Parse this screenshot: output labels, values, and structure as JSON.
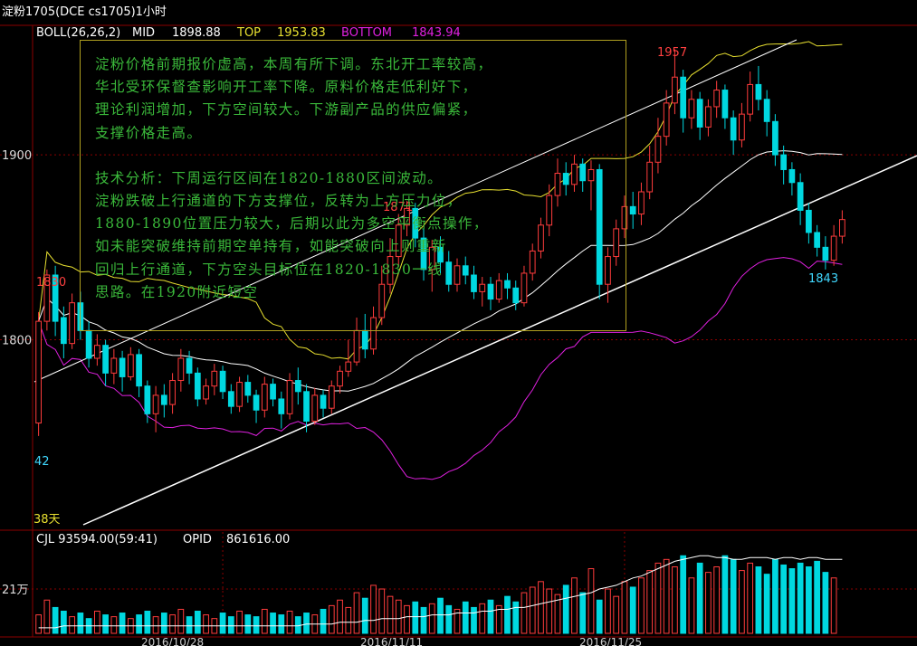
{
  "title": "淀粉1705(DCE cs1705)1小时",
  "indicator": {
    "name": "BOLL(26,26,2)",
    "mid_label": "MID",
    "mid_value": "1898.88",
    "top_label": "TOP",
    "top_value": "1953.83",
    "bottom_label": "BOTTOM",
    "bottom_value": "1843.94"
  },
  "volume_header": {
    "cjl": "CJL 93594.00(59:41)",
    "opid_label": "OPID",
    "opid_value": "861616.00"
  },
  "note": {
    "para1": "淀粉价格前期报价虚高，本周有所下调。东北开工率较高，\n华北受环保督查影响开工率下降。原料价格走低利好下，\n理论利润增加，下方空间较大。下游副产品的供应偏紧，\n支撑价格走高。",
    "para2": "技术分析：下周运行区间在1820-1880区间波动。\n淀粉跌破上行通道的下方支撑位，反转为上方压力位，\n1880-1890位置压力较大，后期以此为多空平衡点操作，\n如未能突破维持前期空单持有，如能突破向上则重新\n回归上行通道，下方空头目标位在1820-1830一线\n思路。在1920附近短空"
  },
  "annotations": {
    "high1": "1830",
    "high2": "1871",
    "high3": "1957",
    "low1": "1843",
    "left_low": "42",
    "days": "38天"
  },
  "colors": {
    "bg": "#000000",
    "up": "#ff3c3c",
    "down": "#00d8e0",
    "grid": "#8b0000",
    "mid": "#ffffff",
    "top": "#e8e030",
    "bottom": "#e020e0",
    "title": "#ffffff",
    "note": "#3ab83a"
  },
  "chart_data": {
    "type": "candlestick",
    "y_ticks": [
      1800,
      1900
    ],
    "ylim": [
      1700,
      1970
    ],
    "volume_tick": "21万",
    "x_ticks": [
      "2016/10/28",
      "2016/11/11",
      "2016/11/25"
    ],
    "x_tick_index": [
      22,
      70,
      118
    ],
    "candles": [
      [
        1755,
        1810,
        1748,
        1815
      ],
      [
        1810,
        1835,
        1805,
        1838
      ],
      [
        1835,
        1810,
        1802,
        1840
      ],
      [
        1812,
        1798,
        1790,
        1818
      ],
      [
        1798,
        1820,
        1795,
        1825
      ],
      [
        1820,
        1805,
        1800,
        1826
      ],
      [
        1805,
        1790,
        1785,
        1810
      ],
      [
        1790,
        1797,
        1786,
        1803
      ],
      [
        1797,
        1782,
        1775,
        1800
      ],
      [
        1782,
        1790,
        1776,
        1795
      ],
      [
        1790,
        1780,
        1772,
        1794
      ],
      [
        1780,
        1792,
        1778,
        1796
      ],
      [
        1792,
        1775,
        1769,
        1795
      ],
      [
        1775,
        1760,
        1755,
        1778
      ],
      [
        1760,
        1770,
        1750,
        1775
      ],
      [
        1770,
        1765,
        1758,
        1776
      ],
      [
        1765,
        1778,
        1760,
        1782
      ],
      [
        1778,
        1790,
        1772,
        1795
      ],
      [
        1790,
        1782,
        1776,
        1794
      ],
      [
        1782,
        1768,
        1764,
        1785
      ],
      [
        1768,
        1775,
        1765,
        1779
      ],
      [
        1775,
        1783,
        1770,
        1787
      ],
      [
        1783,
        1772,
        1768,
        1786
      ],
      [
        1772,
        1764,
        1760,
        1776
      ],
      [
        1764,
        1777,
        1761,
        1780
      ],
      [
        1777,
        1770,
        1766,
        1781
      ],
      [
        1770,
        1762,
        1755,
        1773
      ],
      [
        1762,
        1776,
        1758,
        1780
      ],
      [
        1776,
        1768,
        1764,
        1779
      ],
      [
        1768,
        1760,
        1752,
        1772
      ],
      [
        1760,
        1778,
        1757,
        1782
      ],
      [
        1778,
        1772,
        1765,
        1785
      ],
      [
        1772,
        1756,
        1750,
        1776
      ],
      [
        1756,
        1770,
        1754,
        1774
      ],
      [
        1770,
        1763,
        1758,
        1773
      ],
      [
        1763,
        1775,
        1760,
        1778
      ],
      [
        1775,
        1783,
        1771,
        1786
      ],
      [
        1783,
        1788,
        1780,
        1800
      ],
      [
        1788,
        1805,
        1786,
        1812
      ],
      [
        1805,
        1795,
        1790,
        1814
      ],
      [
        1795,
        1812,
        1792,
        1818
      ],
      [
        1812,
        1830,
        1808,
        1840
      ],
      [
        1830,
        1845,
        1825,
        1855
      ],
      [
        1845,
        1862,
        1840,
        1868
      ],
      [
        1862,
        1871,
        1856,
        1875
      ],
      [
        1871,
        1855,
        1850,
        1874
      ],
      [
        1855,
        1838,
        1832,
        1860
      ],
      [
        1838,
        1850,
        1826,
        1854
      ],
      [
        1850,
        1842,
        1836,
        1856
      ],
      [
        1842,
        1830,
        1826,
        1848
      ],
      [
        1830,
        1840,
        1826,
        1844
      ],
      [
        1840,
        1835,
        1830,
        1845
      ],
      [
        1835,
        1826,
        1822,
        1840
      ],
      [
        1826,
        1830,
        1818,
        1834
      ],
      [
        1830,
        1822,
        1816,
        1834
      ],
      [
        1822,
        1832,
        1820,
        1836
      ],
      [
        1832,
        1828,
        1822,
        1836
      ],
      [
        1828,
        1820,
        1816,
        1832
      ],
      [
        1820,
        1836,
        1818,
        1840
      ],
      [
        1836,
        1848,
        1832,
        1852
      ],
      [
        1848,
        1862,
        1844,
        1866
      ],
      [
        1862,
        1878,
        1856,
        1884
      ],
      [
        1878,
        1890,
        1872,
        1898
      ],
      [
        1890,
        1884,
        1878,
        1896
      ],
      [
        1884,
        1895,
        1880,
        1900
      ],
      [
        1895,
        1886,
        1880,
        1898
      ],
      [
        1886,
        1892,
        1870,
        1897
      ],
      [
        1892,
        1830,
        1822,
        1895
      ],
      [
        1830,
        1845,
        1820,
        1850
      ],
      [
        1845,
        1860,
        1840,
        1865
      ],
      [
        1860,
        1872,
        1855,
        1878
      ],
      [
        1872,
        1868,
        1860,
        1880
      ],
      [
        1868,
        1880,
        1862,
        1885
      ],
      [
        1880,
        1896,
        1876,
        1905
      ],
      [
        1896,
        1910,
        1890,
        1920
      ],
      [
        1910,
        1928,
        1905,
        1935
      ],
      [
        1928,
        1942,
        1922,
        1957
      ],
      [
        1942,
        1920,
        1912,
        1946
      ],
      [
        1920,
        1930,
        1914,
        1935
      ],
      [
        1930,
        1915,
        1908,
        1934
      ],
      [
        1915,
        1926,
        1910,
        1930
      ],
      [
        1926,
        1935,
        1920,
        1940
      ],
      [
        1935,
        1920,
        1914,
        1938
      ],
      [
        1920,
        1908,
        1900,
        1924
      ],
      [
        1908,
        1922,
        1904,
        1928
      ],
      [
        1922,
        1938,
        1918,
        1945
      ],
      [
        1938,
        1930,
        1924,
        1948
      ],
      [
        1930,
        1918,
        1910,
        1935
      ],
      [
        1918,
        1900,
        1894,
        1922
      ],
      [
        1900,
        1892,
        1884,
        1905
      ],
      [
        1892,
        1885,
        1878,
        1896
      ],
      [
        1885,
        1870,
        1862,
        1890
      ],
      [
        1870,
        1858,
        1852,
        1874
      ],
      [
        1858,
        1850,
        1845,
        1862
      ],
      [
        1850,
        1843,
        1838,
        1856
      ],
      [
        1843,
        1856,
        1840,
        1862
      ],
      [
        1856,
        1865,
        1852,
        1870
      ]
    ],
    "volume": [
      10,
      18,
      14,
      12,
      9,
      11,
      8,
      12,
      10,
      9,
      11,
      8,
      10,
      12,
      9,
      11,
      10,
      13,
      9,
      12,
      10,
      8,
      11,
      9,
      12,
      10,
      9,
      13,
      11,
      10,
      12,
      9,
      11,
      10,
      13,
      15,
      18,
      14,
      22,
      19,
      26,
      24,
      20,
      18,
      15,
      17,
      14,
      16,
      19,
      15,
      13,
      17,
      14,
      16,
      18,
      15,
      20,
      17,
      22,
      25,
      28,
      24,
      21,
      26,
      30,
      22,
      35,
      18,
      24,
      20,
      28,
      25,
      30,
      34,
      38,
      40,
      36,
      42,
      30,
      38,
      33,
      36,
      42,
      40,
      34,
      38,
      36,
      32,
      40,
      37,
      35,
      38,
      36,
      39,
      33,
      30
    ],
    "volume_ma": [
      3,
      3,
      3,
      4,
      4,
      4,
      4,
      4,
      4,
      4,
      4,
      4,
      4,
      4,
      4,
      4,
      4,
      4,
      4,
      4,
      4,
      4,
      4,
      4,
      4,
      4,
      4,
      4,
      4,
      4,
      4,
      4,
      5,
      5,
      5,
      5,
      6,
      6,
      6,
      7,
      7,
      8,
      8,
      8,
      9,
      9,
      9,
      10,
      10,
      10,
      11,
      11,
      11,
      12,
      12,
      13,
      13,
      14,
      14,
      15,
      16,
      17,
      18,
      19,
      20,
      21,
      22,
      24,
      25,
      26,
      28,
      30,
      31,
      33,
      35,
      37,
      39,
      40,
      41,
      42,
      42,
      41,
      41,
      40,
      40,
      41,
      41,
      41,
      40,
      41,
      41,
      40,
      41,
      41,
      40,
      40,
      40
    ]
  }
}
